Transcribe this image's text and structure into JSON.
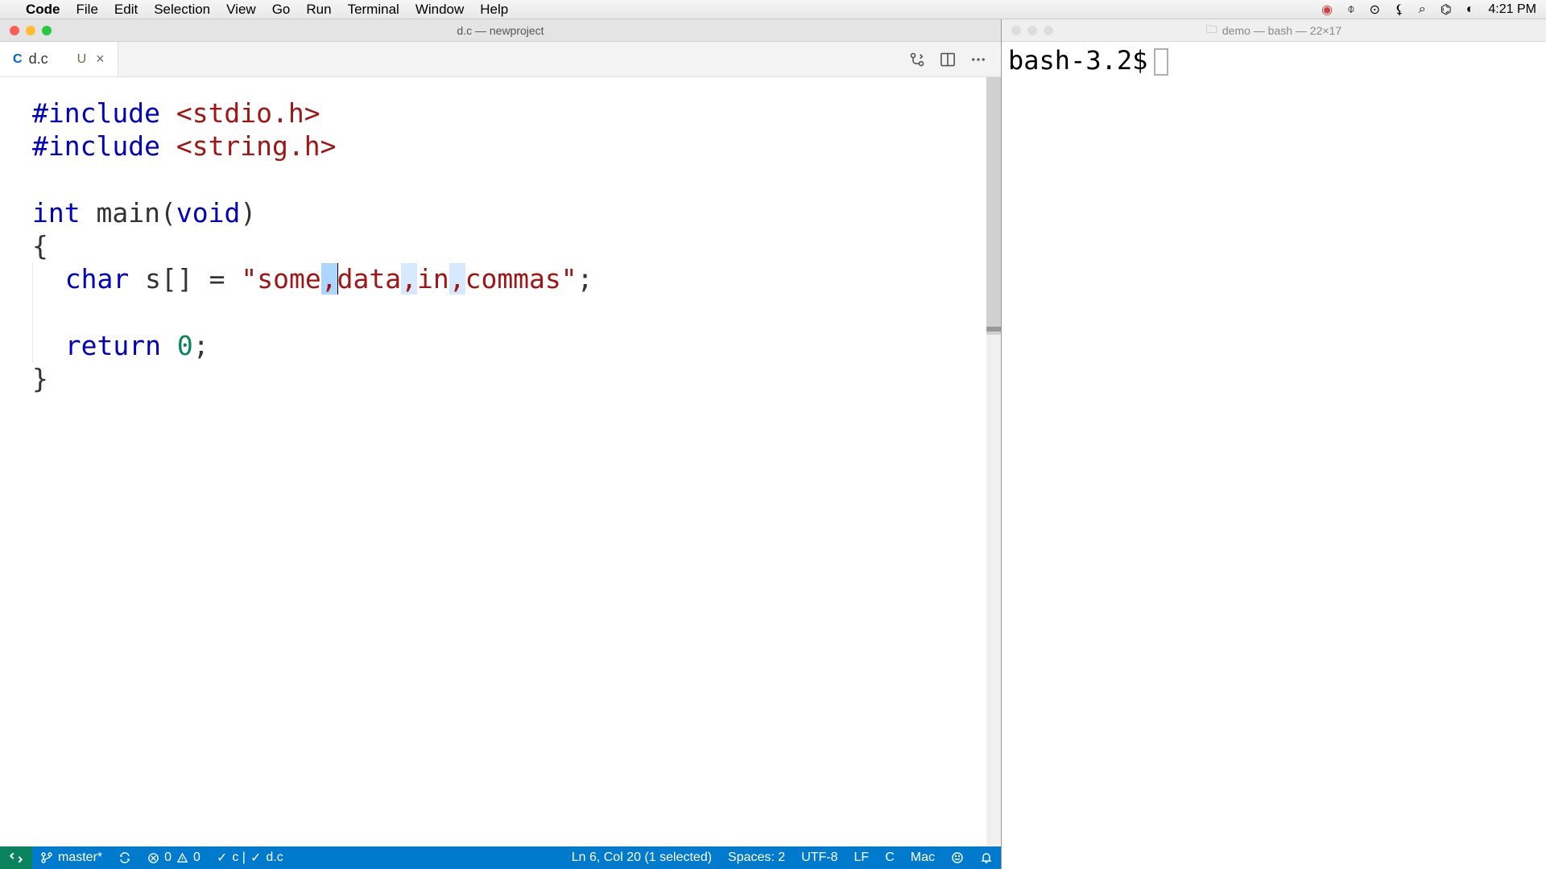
{
  "menubar": {
    "app_name": "Code",
    "items": [
      "File",
      "Edit",
      "Selection",
      "View",
      "Go",
      "Run",
      "Terminal",
      "Window",
      "Help"
    ],
    "clock": "4:21 PM"
  },
  "vscode": {
    "title": "d.c — newproject",
    "tab": {
      "lang_badge": "C",
      "filename": "d.c",
      "modified_badge": "U",
      "close_label": "×"
    },
    "code": {
      "line1_pp": "#include",
      "line1_inc": "<stdio.h>",
      "line2_pp": "#include",
      "line2_inc": "<string.h>",
      "line4_int": "int",
      "line4_main": "main",
      "line4_void": "void",
      "line5_brace": "{",
      "line6_char": "char",
      "line6_s": "s",
      "line6_brackets": "[]",
      "line6_eq": "=",
      "line6_q1": "\"",
      "line6_some": "some",
      "line6_c1": ",",
      "line6_data": "data",
      "line6_c2": ",",
      "line6_in": "in",
      "line6_c3": ",",
      "line6_commas": "commas",
      "line6_q2": "\"",
      "line6_semi": ";",
      "line8_return": "return",
      "line8_zero": "0",
      "line8_semi": ";",
      "line9_brace": "}"
    },
    "statusbar": {
      "branch": "master*",
      "errors": "0",
      "warnings": "0",
      "checks": "c |",
      "checks2": "d.c",
      "cursor": "Ln 6, Col 20 (1 selected)",
      "spaces": "Spaces: 2",
      "encoding": "UTF-8",
      "eol": "LF",
      "lang": "C",
      "os": "Mac"
    }
  },
  "terminal": {
    "title": "demo — bash — 22×17",
    "prompt": "bash-3.2$"
  }
}
